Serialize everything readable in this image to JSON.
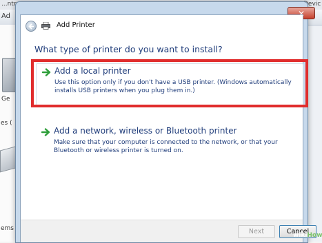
{
  "background": {
    "address_left": "...ntro",
    "address_right": "Devic",
    "toolbar_text": "Ad",
    "left_labels": [
      "Ge",
      "es (",
      "ems"
    ]
  },
  "dialog": {
    "title": "Add Printer",
    "close_label": "✕",
    "heading": "What type of printer do you want to install?",
    "options": [
      {
        "title": "Add a local printer",
        "description": "Use this option only if you don't have a USB printer. (Windows automatically installs USB printers when you plug them in.)"
      },
      {
        "title": "Add a network, wireless or Bluetooth printer",
        "description": "Make sure that your computer is connected to the network, or that your Bluetooth or wireless printer is turned on."
      }
    ],
    "buttons": {
      "next": "Next",
      "cancel": "Cancel"
    }
  },
  "watermark": {
    "wiki": "wiki",
    "how": "How"
  },
  "colors": {
    "highlight": "#e12d2d",
    "link_text": "#1f3c7a",
    "arrow_green": "#2e9e3a"
  }
}
